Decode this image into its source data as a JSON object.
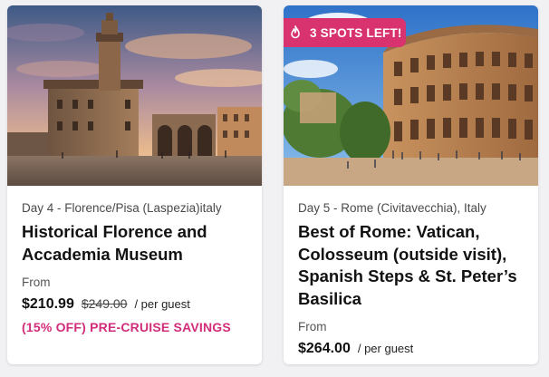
{
  "tours": [
    {
      "day_port": "Day 4 - Florence/Pisa (Laspezia)italy",
      "title": "Historical Florence and Accademia Museum",
      "from_label": "From",
      "price": "$210.99",
      "original_price": "$249.00",
      "per_guest": "/ per guest",
      "savings": "(15% OFF) PRE-CRUISE SAVINGS",
      "image_alt": "Palazzo Vecchio, Piazza della Signoria at sunset"
    },
    {
      "badge_icon": "flame-icon",
      "badge": "3 SPOTS LEFT!",
      "day_port": "Day 5 - Rome (Civitavecchia), Italy",
      "title": "Best of Rome: Vatican, Colosseum (outside visit), Spanish Steps & St. Peter’s Basilica",
      "from_label": "From",
      "price": "$264.00",
      "per_guest": "/ per guest",
      "image_alt": "The Colosseum in Rome under a blue sky"
    }
  ],
  "colors": {
    "savings": "#d22d7a",
    "badge": "#d8336f",
    "card_bg": "#ffffff",
    "page_bg": "#f1f1f3"
  }
}
